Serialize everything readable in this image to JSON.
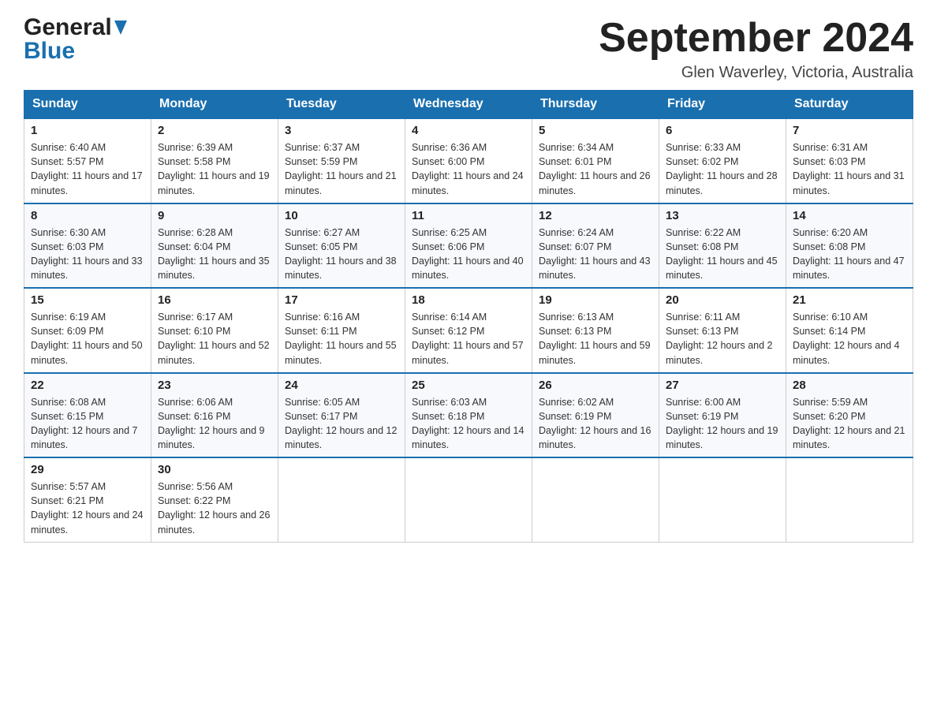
{
  "header": {
    "logo_general": "General",
    "logo_blue": "Blue",
    "month_title": "September 2024",
    "location": "Glen Waverley, Victoria, Australia"
  },
  "days_of_week": [
    "Sunday",
    "Monday",
    "Tuesday",
    "Wednesday",
    "Thursday",
    "Friday",
    "Saturday"
  ],
  "weeks": [
    [
      {
        "day": "1",
        "sunrise": "6:40 AM",
        "sunset": "5:57 PM",
        "daylight": "11 hours and 17 minutes."
      },
      {
        "day": "2",
        "sunrise": "6:39 AM",
        "sunset": "5:58 PM",
        "daylight": "11 hours and 19 minutes."
      },
      {
        "day": "3",
        "sunrise": "6:37 AM",
        "sunset": "5:59 PM",
        "daylight": "11 hours and 21 minutes."
      },
      {
        "day": "4",
        "sunrise": "6:36 AM",
        "sunset": "6:00 PM",
        "daylight": "11 hours and 24 minutes."
      },
      {
        "day": "5",
        "sunrise": "6:34 AM",
        "sunset": "6:01 PM",
        "daylight": "11 hours and 26 minutes."
      },
      {
        "day": "6",
        "sunrise": "6:33 AM",
        "sunset": "6:02 PM",
        "daylight": "11 hours and 28 minutes."
      },
      {
        "day": "7",
        "sunrise": "6:31 AM",
        "sunset": "6:03 PM",
        "daylight": "11 hours and 31 minutes."
      }
    ],
    [
      {
        "day": "8",
        "sunrise": "6:30 AM",
        "sunset": "6:03 PM",
        "daylight": "11 hours and 33 minutes."
      },
      {
        "day": "9",
        "sunrise": "6:28 AM",
        "sunset": "6:04 PM",
        "daylight": "11 hours and 35 minutes."
      },
      {
        "day": "10",
        "sunrise": "6:27 AM",
        "sunset": "6:05 PM",
        "daylight": "11 hours and 38 minutes."
      },
      {
        "day": "11",
        "sunrise": "6:25 AM",
        "sunset": "6:06 PM",
        "daylight": "11 hours and 40 minutes."
      },
      {
        "day": "12",
        "sunrise": "6:24 AM",
        "sunset": "6:07 PM",
        "daylight": "11 hours and 43 minutes."
      },
      {
        "day": "13",
        "sunrise": "6:22 AM",
        "sunset": "6:08 PM",
        "daylight": "11 hours and 45 minutes."
      },
      {
        "day": "14",
        "sunrise": "6:20 AM",
        "sunset": "6:08 PM",
        "daylight": "11 hours and 47 minutes."
      }
    ],
    [
      {
        "day": "15",
        "sunrise": "6:19 AM",
        "sunset": "6:09 PM",
        "daylight": "11 hours and 50 minutes."
      },
      {
        "day": "16",
        "sunrise": "6:17 AM",
        "sunset": "6:10 PM",
        "daylight": "11 hours and 52 minutes."
      },
      {
        "day": "17",
        "sunrise": "6:16 AM",
        "sunset": "6:11 PM",
        "daylight": "11 hours and 55 minutes."
      },
      {
        "day": "18",
        "sunrise": "6:14 AM",
        "sunset": "6:12 PM",
        "daylight": "11 hours and 57 minutes."
      },
      {
        "day": "19",
        "sunrise": "6:13 AM",
        "sunset": "6:13 PM",
        "daylight": "11 hours and 59 minutes."
      },
      {
        "day": "20",
        "sunrise": "6:11 AM",
        "sunset": "6:13 PM",
        "daylight": "12 hours and 2 minutes."
      },
      {
        "day": "21",
        "sunrise": "6:10 AM",
        "sunset": "6:14 PM",
        "daylight": "12 hours and 4 minutes."
      }
    ],
    [
      {
        "day": "22",
        "sunrise": "6:08 AM",
        "sunset": "6:15 PM",
        "daylight": "12 hours and 7 minutes."
      },
      {
        "day": "23",
        "sunrise": "6:06 AM",
        "sunset": "6:16 PM",
        "daylight": "12 hours and 9 minutes."
      },
      {
        "day": "24",
        "sunrise": "6:05 AM",
        "sunset": "6:17 PM",
        "daylight": "12 hours and 12 minutes."
      },
      {
        "day": "25",
        "sunrise": "6:03 AM",
        "sunset": "6:18 PM",
        "daylight": "12 hours and 14 minutes."
      },
      {
        "day": "26",
        "sunrise": "6:02 AM",
        "sunset": "6:19 PM",
        "daylight": "12 hours and 16 minutes."
      },
      {
        "day": "27",
        "sunrise": "6:00 AM",
        "sunset": "6:19 PM",
        "daylight": "12 hours and 19 minutes."
      },
      {
        "day": "28",
        "sunrise": "5:59 AM",
        "sunset": "6:20 PM",
        "daylight": "12 hours and 21 minutes."
      }
    ],
    [
      {
        "day": "29",
        "sunrise": "5:57 AM",
        "sunset": "6:21 PM",
        "daylight": "12 hours and 24 minutes."
      },
      {
        "day": "30",
        "sunrise": "5:56 AM",
        "sunset": "6:22 PM",
        "daylight": "12 hours and 26 minutes."
      },
      null,
      null,
      null,
      null,
      null
    ]
  ],
  "labels": {
    "sunrise_prefix": "Sunrise: ",
    "sunset_prefix": "Sunset: ",
    "daylight_prefix": "Daylight: "
  }
}
